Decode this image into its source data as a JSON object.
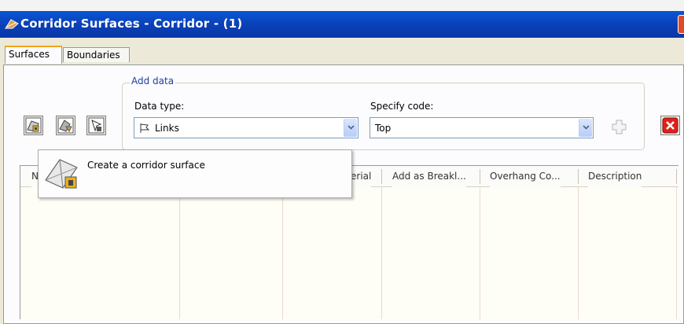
{
  "window": {
    "title": "Corridor Surfaces - Corridor - (1)"
  },
  "tabs": [
    {
      "label": "Surfaces",
      "active": true
    },
    {
      "label": "Boundaries",
      "active": false
    }
  ],
  "add_data": {
    "group_label": "Add data",
    "data_type_label": "Data type:",
    "data_type_value": "Links",
    "specify_code_label": "Specify code:",
    "specify_code_value": "Top"
  },
  "tooltip": {
    "text": "Create a corridor surface"
  },
  "table": {
    "columns": [
      "N",
      "erial",
      "Add as Breakl...",
      "Overhang Co...",
      "Description"
    ]
  },
  "colors": {
    "title_bar": "#0a4fd0",
    "tab_highlight": "#f5a31a",
    "group_legend": "#1d3f9e",
    "delete_red": "#e0201b"
  }
}
